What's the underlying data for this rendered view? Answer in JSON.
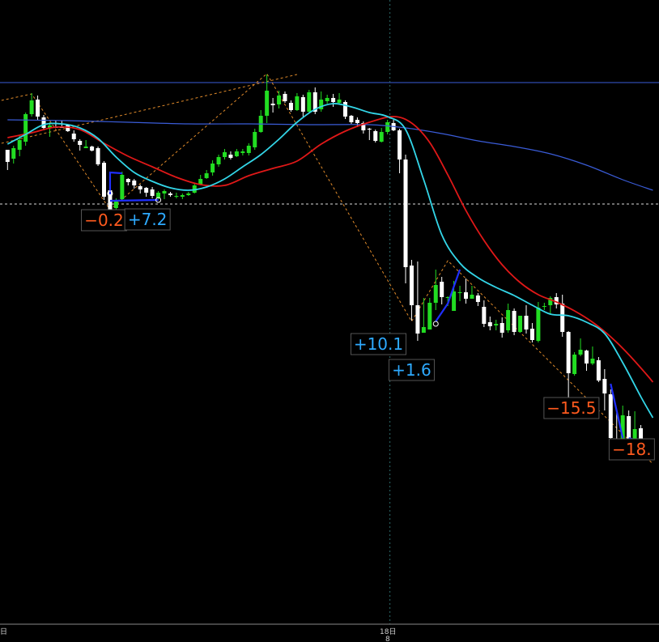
{
  "chart_data": {
    "type": "candlestick",
    "title": "",
    "xlabel": "",
    "ylabel": "",
    "grid": false,
    "x_tick_labels": [
      "日",
      "18日"
    ],
    "x_tick_sublabel": "8",
    "ylim": [
      -30,
      30
    ],
    "colors": {
      "background": "#000000",
      "up_candle": "#22dd22",
      "down_candle": "#ffffff",
      "ma_short": "#33d6e8",
      "ma_mid": "#e01818",
      "ma_long": "#3a5cd8",
      "resistance_line": "#3a5cd8",
      "support_line": "#dddddd",
      "zigzag": "#e08a2a",
      "label_negative": "#ff5a1e",
      "label_positive": "#2eaaff",
      "label_box": "#555555"
    },
    "horizontal_levels": {
      "resistance": 25.0,
      "support": 10.0
    },
    "candles": [
      [
        16.7,
        15.2,
        15.9,
        14.2
      ],
      [
        15.6,
        16.9,
        17.2,
        15.0
      ],
      [
        16.7,
        17.9,
        18.4,
        15.9
      ],
      [
        17.7,
        21.1,
        21.3,
        17.2
      ],
      [
        21.1,
        22.8,
        23.7,
        20.8
      ],
      [
        22.9,
        20.8,
        23.4,
        20.3
      ],
      [
        20.7,
        19.4,
        21.0,
        19.1
      ],
      [
        19.4,
        19.7,
        20.1,
        18.3
      ],
      [
        19.5,
        19.4,
        20.3,
        19.4
      ],
      [
        19.5,
        19.4,
        20.3,
        19.4
      ],
      [
        19.8,
        19.0,
        19.9,
        18.9
      ],
      [
        18.7,
        18.0,
        19.1,
        17.7
      ],
      [
        17.8,
        17.3,
        18.0,
        16.6
      ],
      [
        16.9,
        17.1,
        17.9,
        16.9
      ],
      [
        17.1,
        16.6,
        17.2,
        16.5
      ],
      [
        16.9,
        14.9,
        17.1,
        14.7
      ],
      [
        15.1,
        10.9,
        15.3,
        10.5
      ],
      [
        11.7,
        9.3,
        12.5,
        9.1
      ],
      [
        9.5,
        10.3,
        10.7,
        9.1
      ],
      [
        10.6,
        13.6,
        14.0,
        10.5
      ],
      [
        13.1,
        12.7,
        13.2,
        12.3
      ],
      [
        12.9,
        12.3,
        13.1,
        11.9
      ],
      [
        12.2,
        11.8,
        12.4,
        11.3
      ],
      [
        12.0,
        11.4,
        12.1,
        10.9
      ],
      [
        11.8,
        11.0,
        12.1,
        10.7
      ],
      [
        10.7,
        11.4,
        11.6,
        10.6
      ],
      [
        11.3,
        11.6,
        11.8,
        10.6
      ],
      [
        11.3,
        11.1,
        11.5,
        10.9
      ],
      [
        11.0,
        11.0,
        11.4,
        10.7
      ],
      [
        10.9,
        11.1,
        11.3,
        10.6
      ],
      [
        11.1,
        11.3,
        11.5,
        11.0
      ],
      [
        11.4,
        12.3,
        12.6,
        11.3
      ],
      [
        12.4,
        13.1,
        13.6,
        12.3
      ],
      [
        13.2,
        13.8,
        14.2,
        13.1
      ],
      [
        13.9,
        15.0,
        15.4,
        13.5
      ],
      [
        14.9,
        15.8,
        16.1,
        14.6
      ],
      [
        15.8,
        16.4,
        16.8,
        15.5
      ],
      [
        16.1,
        15.7,
        16.5,
        15.5
      ],
      [
        15.9,
        16.5,
        16.8,
        15.8
      ],
      [
        16.3,
        16.5,
        16.8,
        16.0
      ],
      [
        16.3,
        17.2,
        17.5,
        16.0
      ],
      [
        17.0,
        18.9,
        19.3,
        16.7
      ],
      [
        18.9,
        20.9,
        21.6,
        18.8
      ],
      [
        20.9,
        24.0,
        26.0,
        20.0
      ],
      [
        22.4,
        22.2,
        23.1,
        21.3
      ],
      [
        22.3,
        23.4,
        24.0,
        21.8
      ],
      [
        23.6,
        22.7,
        23.9,
        22.5
      ],
      [
        22.5,
        21.6,
        22.8,
        21.4
      ],
      [
        21.6,
        23.3,
        23.7,
        21.5
      ],
      [
        23.2,
        21.4,
        23.5,
        20.8
      ],
      [
        21.4,
        23.8,
        24.1,
        21.2
      ],
      [
        23.8,
        21.4,
        24.4,
        21.1
      ],
      [
        21.7,
        22.9,
        23.9,
        21.4
      ],
      [
        22.7,
        23.1,
        23.5,
        22.4
      ],
      [
        23.1,
        22.6,
        23.6,
        22.0
      ],
      [
        22.5,
        22.9,
        23.7,
        22.4
      ],
      [
        22.6,
        20.8,
        22.8,
        20.5
      ],
      [
        20.9,
        20.1,
        21.0,
        19.9
      ],
      [
        20.4,
        20.0,
        20.7,
        19.5
      ],
      [
        20.0,
        19.1,
        20.2,
        18.7
      ],
      [
        19.3,
        19.2,
        19.4,
        17.9
      ],
      [
        19.0,
        17.8,
        19.2,
        17.6
      ],
      [
        17.7,
        18.9,
        19.4,
        17.6
      ],
      [
        18.9,
        20.1,
        20.4,
        18.6
      ],
      [
        20.0,
        19.1,
        20.4,
        19.0
      ],
      [
        19.1,
        15.5,
        19.3,
        13.8
      ],
      [
        15.5,
        2.2,
        16.1,
        0.2
      ],
      [
        2.4,
        -2.5,
        3.1,
        -4.4
      ],
      [
        -2.5,
        -6.0,
        2.9,
        -6.9
      ],
      [
        -5.9,
        -5.2,
        -1.6,
        -5.6
      ],
      [
        -5.5,
        -2.2,
        -1.6,
        -4.3
      ],
      [
        -2.2,
        0.0,
        1.9,
        -3.1
      ],
      [
        0.4,
        -1.5,
        1.0,
        -2.4
      ],
      [
        -1.5,
        -1.5,
        -1.4,
        -2.6
      ],
      [
        -3.2,
        -0.8,
        0.5,
        -3.2
      ],
      [
        -0.9,
        -0.9,
        -0.1,
        -2.0
      ],
      [
        -0.9,
        -1.7,
        0.8,
        -2.3
      ],
      [
        -1.7,
        -1.2,
        -0.1,
        -1.7
      ],
      [
        -1.3,
        -2.1,
        -1.0,
        -2.6
      ],
      [
        -2.7,
        -4.8,
        -1.9,
        -5.2
      ],
      [
        -4.6,
        -5.1,
        -3.9,
        -5.6
      ],
      [
        -5.0,
        -4.8,
        -4.3,
        -5.6
      ],
      [
        -4.7,
        -5.9,
        -4.0,
        -6.5
      ],
      [
        -5.6,
        -3.1,
        -2.3,
        -5.9
      ],
      [
        -3.2,
        -5.8,
        -2.9,
        -6.2
      ],
      [
        -5.8,
        -3.8,
        -3.8,
        -5.9
      ],
      [
        -3.8,
        -5.5,
        -2.5,
        -6.0
      ],
      [
        -5.4,
        -6.8,
        -4.7,
        -7.1
      ],
      [
        -6.9,
        -2.8,
        -2.1,
        -7.1
      ],
      [
        -2.6,
        -2.6,
        -2.2,
        -3.1
      ],
      [
        -2.5,
        -1.6,
        -1.4,
        -3.7
      ],
      [
        -1.5,
        -2.4,
        -1.0,
        -2.9
      ],
      [
        -2.3,
        -5.8,
        -1.2,
        -6.4
      ],
      [
        -5.8,
        -10.9,
        -5.7,
        -16.5
      ],
      [
        -11.0,
        -8.6,
        -8.3,
        -11.2
      ],
      [
        -8.6,
        -8.0,
        -6.6,
        -8.8
      ],
      [
        -8.1,
        -9.7,
        -8.0,
        -10.6
      ],
      [
        -9.7,
        -9.1,
        -7.6,
        -9.9
      ],
      [
        -9.3,
        -11.8,
        -8.9,
        -12.0
      ],
      [
        -11.6,
        -13.4,
        -10.4,
        -15.5
      ],
      [
        -13.5,
        -18.9,
        -12.9,
        -19.3
      ],
      [
        -19.1,
        -19.4,
        -15.8,
        -19.8
      ],
      [
        -19.6,
        -16.1,
        -14.9,
        -19.6
      ],
      [
        -16.2,
        -19.0,
        -15.5,
        -19.8
      ],
      [
        -19.1,
        -17.8,
        -15.6,
        -20.1
      ],
      [
        -17.7,
        -21.4,
        -17.3,
        -21.6
      ]
    ],
    "ma_short": [
      [
        0,
        17.4
      ],
      [
        3,
        18.6
      ],
      [
        6,
        19.8
      ],
      [
        9,
        19.9
      ],
      [
        12,
        19.4
      ],
      [
        15,
        18.1
      ],
      [
        18,
        15.8
      ],
      [
        21,
        13.9
      ],
      [
        24,
        12.8
      ],
      [
        27,
        12.0
      ],
      [
        30,
        11.7
      ],
      [
        33,
        12.1
      ],
      [
        36,
        13.1
      ],
      [
        39,
        14.6
      ],
      [
        42,
        16.1
      ],
      [
        45,
        18.0
      ],
      [
        48,
        20.1
      ],
      [
        51,
        21.7
      ],
      [
        54,
        22.4
      ],
      [
        57,
        22.0
      ],
      [
        60,
        21.3
      ],
      [
        63,
        20.8
      ],
      [
        66,
        19.2
      ],
      [
        69,
        13.0
      ],
      [
        72,
        6.2
      ],
      [
        75,
        2.7
      ],
      [
        78,
        0.9
      ],
      [
        81,
        -0.3
      ],
      [
        84,
        -1.3
      ],
      [
        87,
        -2.5
      ],
      [
        90,
        -3.6
      ],
      [
        93,
        -3.8
      ],
      [
        96,
        -4.6
      ],
      [
        99,
        -6.0
      ],
      [
        102,
        -9.6
      ],
      [
        105,
        -13.8
      ],
      [
        107,
        -16.4
      ]
    ],
    "ma_mid": [
      [
        0,
        18.2
      ],
      [
        4,
        18.8
      ],
      [
        8,
        19.5
      ],
      [
        12,
        19.2
      ],
      [
        16,
        17.5
      ],
      [
        20,
        15.9
      ],
      [
        24,
        14.6
      ],
      [
        28,
        13.3
      ],
      [
        32,
        12.4
      ],
      [
        36,
        12.3
      ],
      [
        40,
        13.5
      ],
      [
        44,
        14.4
      ],
      [
        48,
        15.3
      ],
      [
        52,
        17.4
      ],
      [
        56,
        19.0
      ],
      [
        60,
        20.1
      ],
      [
        64,
        20.8
      ],
      [
        67,
        20.0
      ],
      [
        70,
        17.6
      ],
      [
        73,
        13.6
      ],
      [
        76,
        9.2
      ],
      [
        79,
        5.5
      ],
      [
        82,
        2.5
      ],
      [
        85,
        0.3
      ],
      [
        88,
        -1.2
      ],
      [
        91,
        -2.1
      ],
      [
        94,
        -3.2
      ],
      [
        97,
        -4.6
      ],
      [
        100,
        -6.4
      ],
      [
        103,
        -8.6
      ],
      [
        106,
        -11.1
      ],
      [
        107,
        -12.0
      ]
    ],
    "ma_long": [
      [
        0,
        20.4
      ],
      [
        10,
        20.3
      ],
      [
        20,
        20.1
      ],
      [
        30,
        19.9
      ],
      [
        40,
        19.9
      ],
      [
        50,
        19.8
      ],
      [
        60,
        19.8
      ],
      [
        66,
        19.4
      ],
      [
        72,
        18.7
      ],
      [
        78,
        17.8
      ],
      [
        84,
        17.1
      ],
      [
        90,
        16.2
      ],
      [
        96,
        14.8
      ],
      [
        102,
        13.0
      ],
      [
        107,
        11.7
      ]
    ],
    "zigzag": [
      [
        -1,
        22.8
      ],
      [
        4,
        23.6
      ],
      [
        17,
        9.3
      ],
      [
        43,
        26.1
      ],
      [
        67,
        -4.5
      ],
      [
        73,
        3.0
      ],
      [
        107,
        -22.1
      ]
    ],
    "support_trendline": [
      [
        -1,
        17.5
      ],
      [
        48,
        26.0
      ]
    ],
    "boxes": [
      {
        "points": [
          [
            17,
            11.2
          ],
          [
            17,
            13.9
          ],
          [
            19,
            13.8
          ]
        ],
        "marker": [
          17,
          11.3
        ]
      },
      {
        "points": [
          [
            17,
            10.4
          ],
          [
            25,
            10.5
          ]
        ],
        "marker": [
          25,
          10.5
        ]
      },
      {
        "points": [
          [
            71,
            -4.5
          ],
          [
            73,
            -2.3
          ],
          [
            75,
            1.9
          ]
        ],
        "marker": [
          71,
          -4.8
        ]
      },
      {
        "points": [
          [
            100,
            -12.2
          ],
          [
            102,
            -18.9
          ]
        ],
        "marker": [
          102,
          -19.3
        ]
      },
      {
        "points": [
          [
            103,
            -18.9
          ],
          [
            106,
            -19.6
          ]
        ],
        "marker": [
          103,
          -19.3
        ]
      }
    ],
    "annotations": [
      {
        "text": "−0.2",
        "kind": "negative",
        "x": 16,
        "y": 8.0,
        "anchor": "center"
      },
      {
        "text": "+7.2",
        "kind": "positive",
        "x": 23.2,
        "y": 8.1,
        "anchor": "center"
      },
      {
        "text": "+10.1",
        "kind": "positive",
        "x": 61.5,
        "y": -7.3,
        "anchor": "center"
      },
      {
        "text": "+1.6",
        "kind": "positive",
        "x": 67,
        "y": -10.5,
        "anchor": "center"
      },
      {
        "text": "−15.5",
        "kind": "negative",
        "x": 93.5,
        "y": -15.2,
        "anchor": "center"
      },
      {
        "text": "−18.",
        "kind": "negative",
        "x": 103.5,
        "y": -20.3,
        "anchor": "center"
      }
    ],
    "vertical_marker_index": 63.4
  }
}
